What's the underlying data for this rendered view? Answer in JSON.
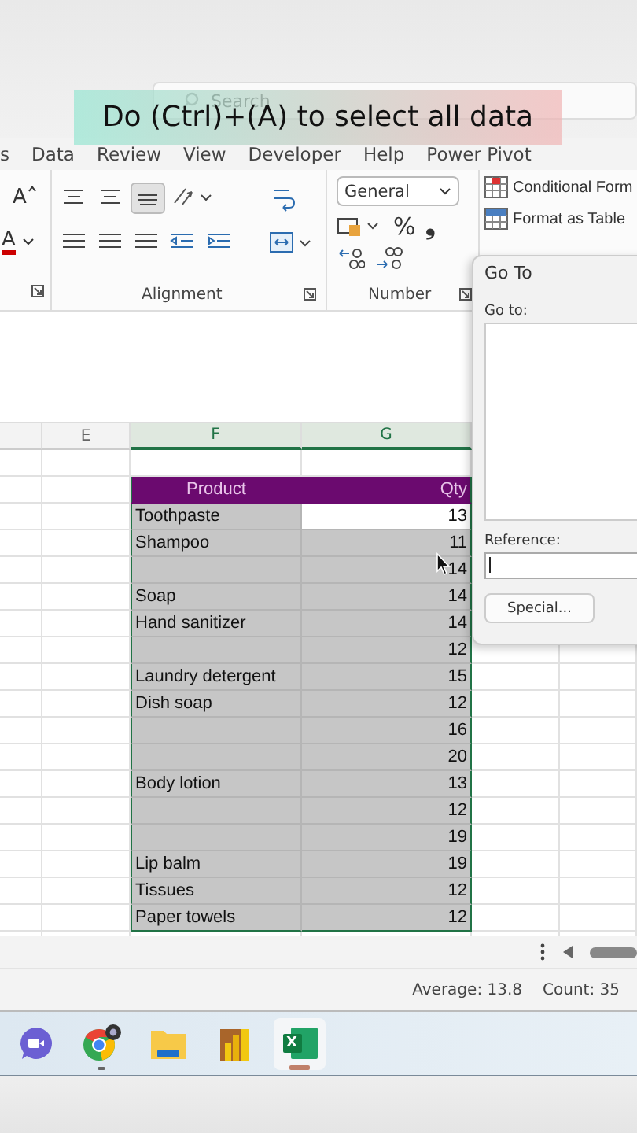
{
  "caption": "Do (Ctrl)+(A) to select all data",
  "search": {
    "placeholder": "Search"
  },
  "menu_tabs": [
    "s",
    "Data",
    "Review",
    "View",
    "Developer",
    "Help",
    "Power Pivot"
  ],
  "ribbon": {
    "grow_font": "A",
    "font_color": "A",
    "number_format": "General",
    "percent": "%",
    "comma": "❟",
    "group_labels": [
      "Alignment",
      "Number"
    ],
    "styles": [
      "Conditional Form",
      "Format as Table"
    ]
  },
  "column_headers": [
    {
      "label": "E",
      "selected": false
    },
    {
      "label": "F",
      "selected": true
    },
    {
      "label": "G",
      "selected": true
    }
  ],
  "table": {
    "columns": [
      "Product",
      "Qty"
    ],
    "rows": [
      {
        "product": "Toothpaste",
        "qty": "13",
        "active": true
      },
      {
        "product": "Shampoo",
        "qty": "11",
        "active": false
      },
      {
        "product": "",
        "qty": "14",
        "active": false
      },
      {
        "product": "Soap",
        "qty": "14",
        "active": false
      },
      {
        "product": "Hand sanitizer",
        "qty": "14",
        "active": false
      },
      {
        "product": "",
        "qty": "12",
        "active": false
      },
      {
        "product": "Laundry detergent",
        "qty": "15",
        "active": false
      },
      {
        "product": "Dish soap",
        "qty": "12",
        "active": false
      },
      {
        "product": "",
        "qty": "16",
        "active": false
      },
      {
        "product": "",
        "qty": "20",
        "active": false
      },
      {
        "product": "Body lotion",
        "qty": "13",
        "active": false
      },
      {
        "product": "",
        "qty": "12",
        "active": false
      },
      {
        "product": "",
        "qty": "19",
        "active": false
      },
      {
        "product": "Lip balm",
        "qty": "19",
        "active": false
      },
      {
        "product": "Tissues",
        "qty": "12",
        "active": false
      },
      {
        "product": "Paper towels",
        "qty": "12",
        "active": false
      }
    ]
  },
  "dialog": {
    "title": "Go To",
    "list_label": "Go to:",
    "reference_label": "Reference:",
    "button": "Special..."
  },
  "status_bar": [
    "Average: 13.8",
    "Count: 35"
  ],
  "taskbar": [
    {
      "kind": "video",
      "active": false
    },
    {
      "kind": "browser",
      "active": false
    },
    {
      "kind": "folder",
      "active": false
    },
    {
      "kind": "chart",
      "active": false
    },
    {
      "kind": "spreadsheet",
      "active": true,
      "glyph": "X"
    }
  ]
}
